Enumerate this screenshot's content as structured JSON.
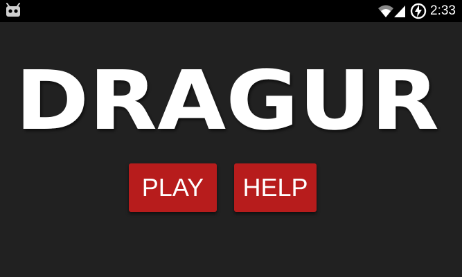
{
  "status_bar": {
    "time": "2:33",
    "left_icon": "robot-notification-icon",
    "icons": [
      "wifi-icon",
      "signal-icon",
      "battery-charging-icon"
    ]
  },
  "logo": {
    "text": "DRAGUR"
  },
  "menu": {
    "play_label": "PLAY",
    "help_label": "HELP"
  },
  "colors": {
    "background": "#212121",
    "status_bar": "#000000",
    "button": "#b71c1c",
    "logo": "#ffffff"
  }
}
